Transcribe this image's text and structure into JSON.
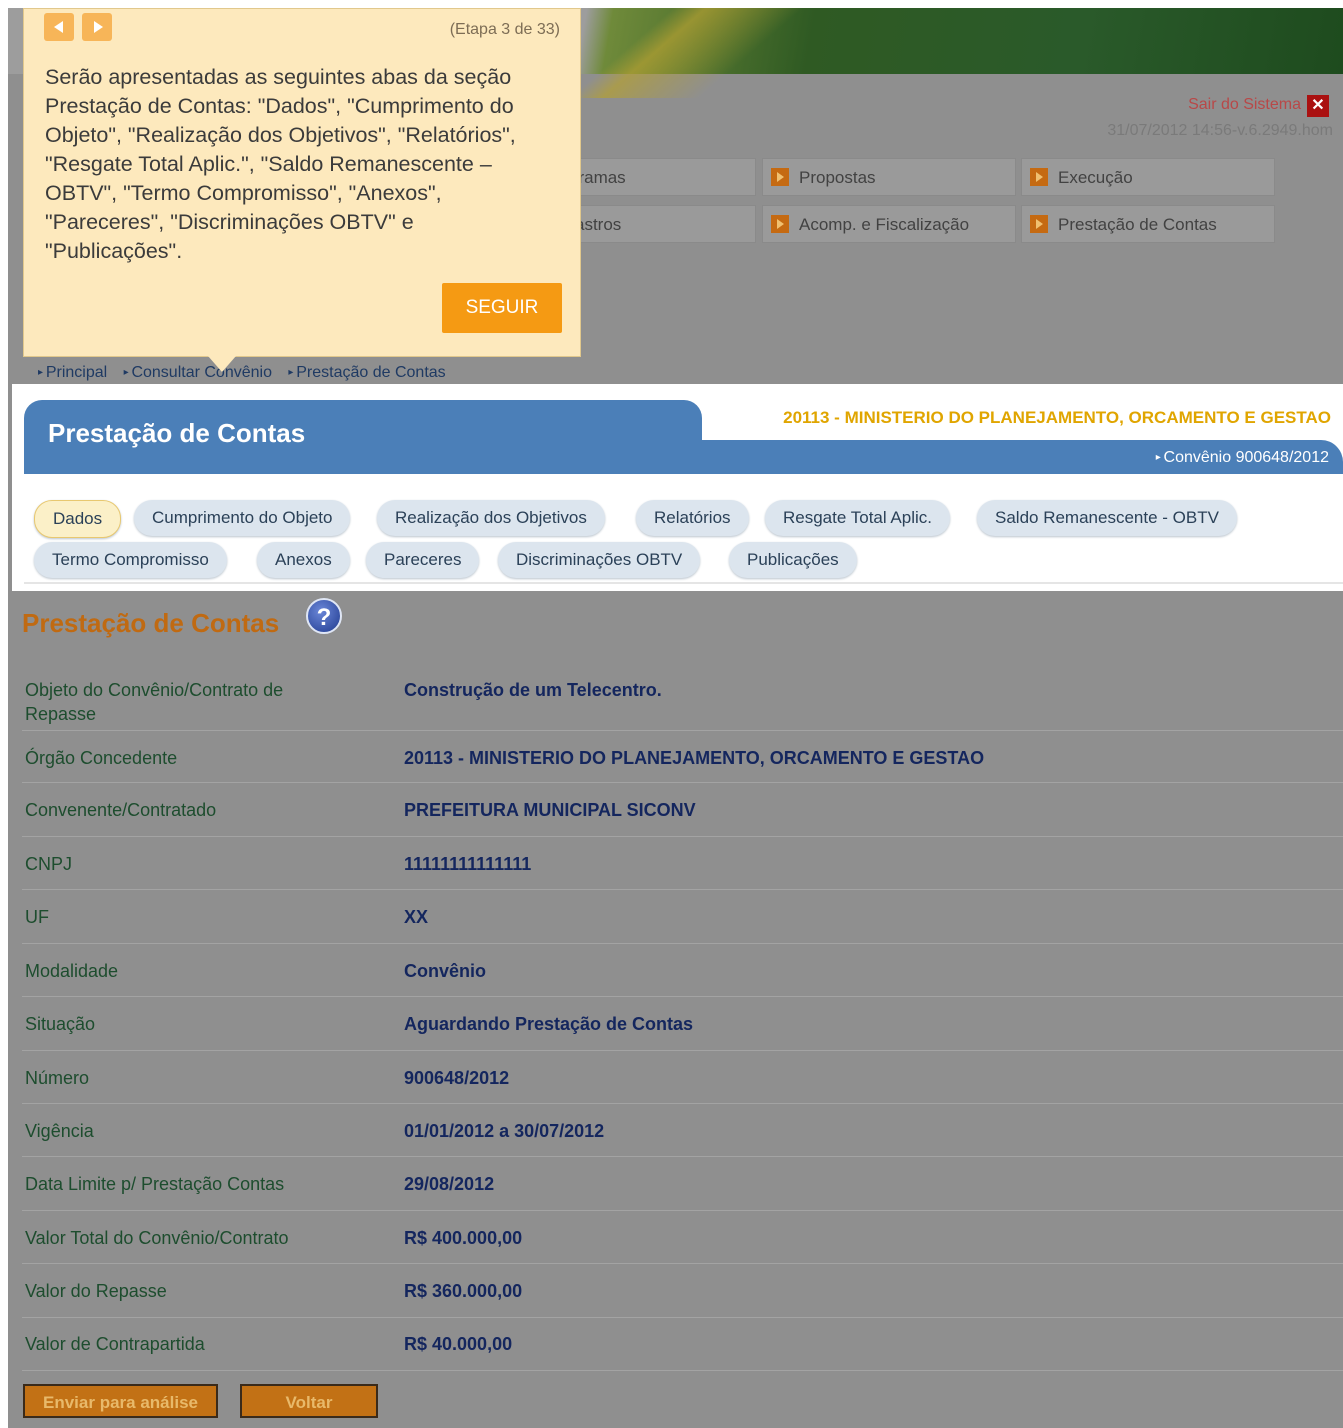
{
  "tooltip": {
    "step_label": "(Etapa 3 de 33)",
    "text": "Serão apresentadas as seguintes abas da seção Prestação de Contas: \"Dados\", \"Cumprimento do Objeto\", \"Realização dos Objetivos\", \"Relatórios\", \"Resgate Total Aplic.\", \"Saldo Remanescente – OBTV\", \"Termo Compromisso\", \"Anexos\", \"Pareceres\", \"Discriminações OBTV\" e \"Publicações\".",
    "next_label": "SEGUIR"
  },
  "header": {
    "exit_label": "Sair do Sistema",
    "version": "31/07/2012 14:56-v.6.2949.hom",
    "exit_icon": "close-x-icon"
  },
  "menu": {
    "items": [
      {
        "label": "gramas"
      },
      {
        "label": "Propostas"
      },
      {
        "label": "Execução"
      },
      {
        "label": "astros"
      },
      {
        "label": "Acomp. e Fiscalização"
      },
      {
        "label": "Prestação de Contas"
      }
    ]
  },
  "breadcrumb": [
    "Principal",
    "Consultar Convênio",
    "Prestação de Contas"
  ],
  "panel": {
    "title": "Prestação de Contas",
    "org": "20113 - MINISTERIO DO PLANEJAMENTO, ORCAMENTO E GESTAO",
    "convenio_link": "Convênio 900648/2012"
  },
  "tabs": [
    {
      "label": "Dados"
    },
    {
      "label": "Cumprimento do Objeto"
    },
    {
      "label": "Realização dos Objetivos"
    },
    {
      "label": "Relatórios"
    },
    {
      "label": "Resgate Total Aplic."
    },
    {
      "label": "Saldo Remanescente - OBTV"
    },
    {
      "label": "Termo Compromisso"
    },
    {
      "label": "Anexos"
    },
    {
      "label": "Pareceres"
    },
    {
      "label": "Discriminações OBTV"
    },
    {
      "label": "Publicações"
    }
  ],
  "section": {
    "title": "Prestação de Contas",
    "help_icon": "?"
  },
  "fields": [
    {
      "label": "Objeto do Convênio/Contrato de Repasse",
      "value": "Construção de um Telecentro."
    },
    {
      "label": "Órgão Concedente",
      "value": "20113 - MINISTERIO DO PLANEJAMENTO, ORCAMENTO E GESTAO"
    },
    {
      "label": "Convenente/Contratado",
      "value": "PREFEITURA MUNICIPAL SICONV"
    },
    {
      "label": "CNPJ",
      "value": "11111111111111"
    },
    {
      "label": "UF",
      "value": "XX"
    },
    {
      "label": "Modalidade",
      "value": "Convênio"
    },
    {
      "label": "Situação",
      "value": "Aguardando Prestação de Contas"
    },
    {
      "label": "Número",
      "value": "900648/2012"
    },
    {
      "label": "Vigência",
      "value": "01/01/2012 a 30/07/2012"
    },
    {
      "label": "Data Limite p/ Prestação Contas",
      "value": "29/08/2012"
    },
    {
      "label": "Valor Total do Convênio/Contrato",
      "value": "R$ 400.000,00"
    },
    {
      "label": "Valor do Repasse",
      "value": "R$ 360.000,00"
    },
    {
      "label": "Valor de Contrapartida",
      "value": "R$ 40.000,00"
    }
  ],
  "actions": {
    "send_label": "Enviar para análise",
    "back_label": "Voltar"
  }
}
